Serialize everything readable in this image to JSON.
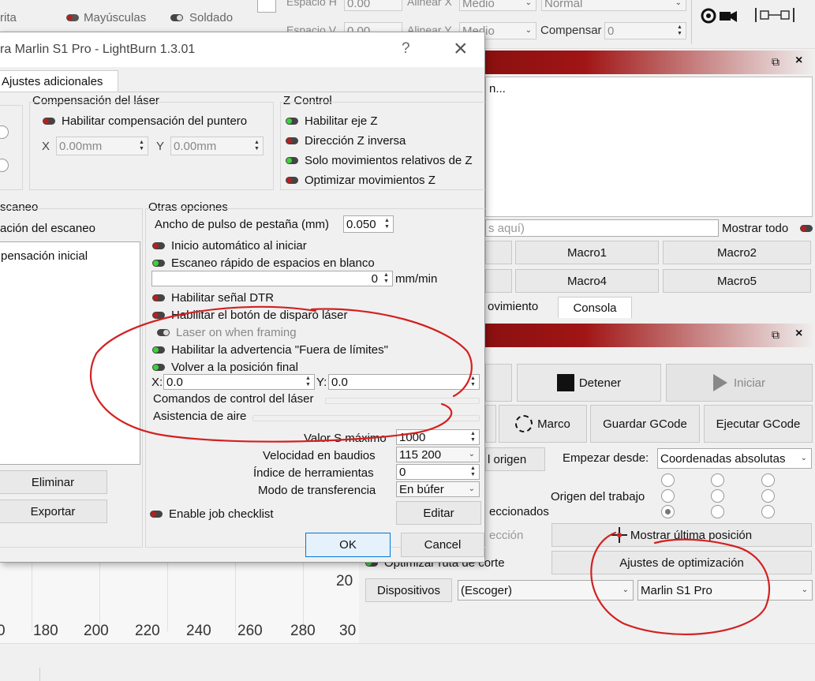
{
  "top_toolbar": {
    "text_item_1": "rita",
    "mayusculas": "Mayúsculas",
    "soldado": "Soldado",
    "espacio_h_label": "Espacio H",
    "espacio_h_value": "0.00",
    "espacio_v_label": "Espacio V",
    "espacio_v_value": "0.00",
    "alinear_x_label": "Alinear X",
    "alinear_x_value": "Medio",
    "alinear_y_label": "Alinear Y",
    "alinear_y_value": "Medio",
    "normal_value": "Normal",
    "compensar_label": "Compensar",
    "compensar_value": "0"
  },
  "console_panel": {
    "output_text": "n...",
    "command_placeholder": "s aquí)",
    "mostrar_todo": "Mostrar todo",
    "macros": [
      "Macro1",
      "Macro2",
      "Macro4",
      "Macro5"
    ],
    "tab_movimiento": "ovimiento",
    "tab_consola": "Consola"
  },
  "laser_panel": {
    "detener": "Detener",
    "iniciar": "Iniciar",
    "marco": "Marco",
    "guardar_gcode": "Guardar GCode",
    "ejecutar_gcode": "Ejecutar GCode",
    "origen_btn": "l origen",
    "empezar_desde_label": "Empezar desde:",
    "empezar_desde_value": "Coordenadas absolutas",
    "origen_trabajo_label": "Origen del trabajo",
    "seleccionados": "eccionados",
    "seleccion": "ección",
    "mostrar_ultima": "Mostrar última posición",
    "optimizar_ruta": "Optimizar ruta de corte",
    "ajustes_optimizacion": "Ajustes de optimización",
    "dispositivos": "Dispositivos",
    "escoger": "(Escoger)",
    "device_value": "Marlin S1 Pro"
  },
  "ruler": {
    "ticks": [
      "0",
      "180",
      "200",
      "220",
      "240",
      "260",
      "280",
      "30"
    ],
    "side_tick": "20"
  },
  "dialog": {
    "title": "ra Marlin S1 Pro - LightBurn 1.3.01",
    "help_glyph": "?",
    "close_glyph": "×",
    "tab_label": "Ajustes adicionales",
    "comp_laser_title": "Compensación del láser",
    "habilitar_comp": "Habilitar compensación del puntero",
    "x_label": "X",
    "x_value": "0.00mm",
    "y_label": "Y",
    "y_value": "0.00mm",
    "zcontrol_title": "Z Control",
    "habilitar_eje_z": "Habilitar eje Z",
    "direccion_z": "Dirección Z inversa",
    "solo_mov_z": "Solo movimientos relativos de Z",
    "optimizar_mov_z": "Optimizar movimientos Z",
    "escaneo_title": "scaneo",
    "escaneo_sub": "ación del escaneo",
    "escaneo_list_item": "pensación inicial",
    "eliminar": "Eliminar",
    "exportar": "Exportar",
    "otras_title": "Otras opciones",
    "ancho_pulso_label": "Ancho de pulso de pestaña (mm)",
    "ancho_pulso_value": "0.050",
    "inicio_auto": "Inicio automático al iniciar",
    "escaneo_rapido": "Escaneo rápido de espacios en blanco",
    "velocidad_value": "0",
    "velocidad_unit": "mm/min",
    "senal_dtr": "Habilitar señal DTR",
    "boton_disparo": "Habilitar el botón de disparo láser",
    "laser_framing": "Laser on when framing",
    "advertencia": "Habilitar la advertencia \"Fuera de límites\"",
    "volver_posicion": "Volver a la posición final",
    "final_x_label": "X:",
    "final_x_value": "0.0",
    "final_y_label": "Y:",
    "final_y_value": "0.0",
    "comandos_control": "Comandos de control del láser",
    "asistencia_aire": "Asistencia de aire",
    "valor_s_label": "Valor S máximo",
    "valor_s_value": "1000",
    "baudios_label": "Velocidad en baudios",
    "baudios_value": "115 200",
    "herramientas_label": "Índice de herramientas",
    "herramientas_value": "0",
    "transferencia_label": "Modo de transferencia",
    "transferencia_value": "En búfer",
    "job_checklist": "Enable job checklist",
    "editar": "Editar",
    "ok": "OK",
    "cancel": "Cancel"
  },
  "colors": {
    "dock_header": "#8b1010",
    "annotation_ink": "#d42020",
    "toggle_on": "#3bd13b",
    "toggle_off": "#b32020"
  }
}
